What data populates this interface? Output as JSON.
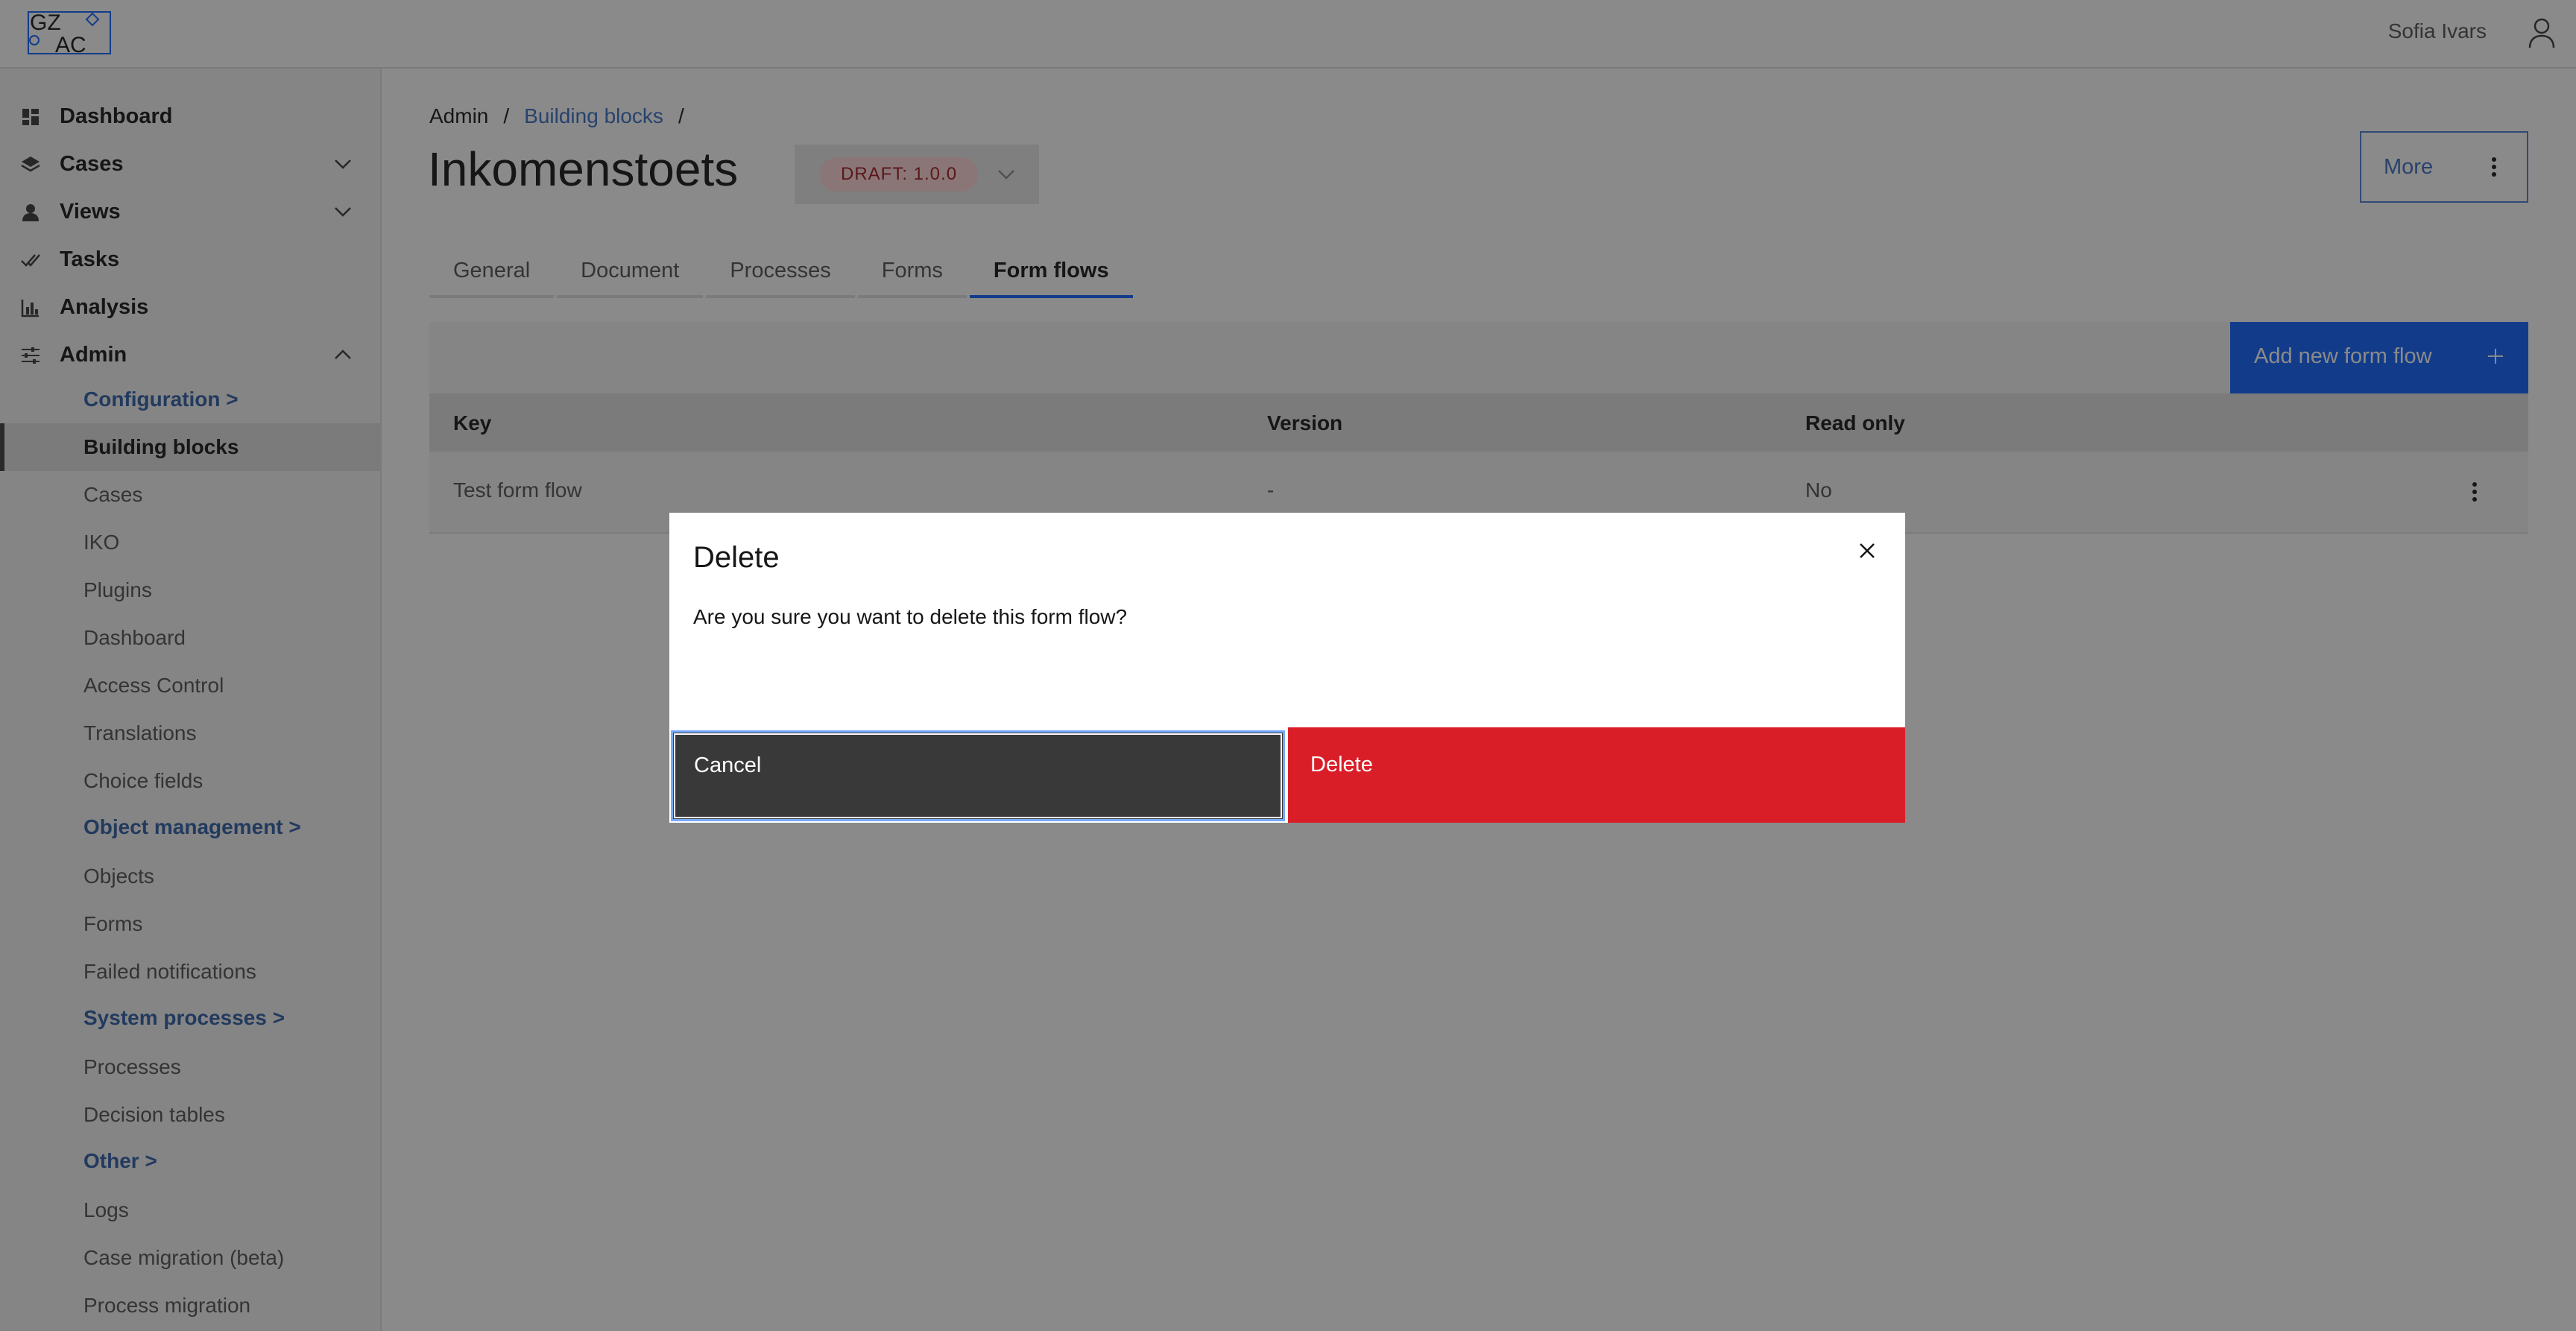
{
  "header": {
    "logo_text_top": "GZ",
    "logo_text_bottom": "AC",
    "user_name": "Sofia Ivars"
  },
  "sidebar": {
    "items": [
      {
        "label": "Dashboard",
        "icon": "dashboard-icon"
      },
      {
        "label": "Cases",
        "icon": "layers-icon"
      },
      {
        "label": "Views",
        "icon": "person-icon"
      },
      {
        "label": "Tasks",
        "icon": "checkmark-icon"
      },
      {
        "label": "Analysis",
        "icon": "bar-chart-icon"
      },
      {
        "label": "Admin",
        "icon": "settings-adjust-icon"
      }
    ],
    "admin_sub": {
      "configuration": "Configuration >",
      "building_blocks": "Building blocks",
      "cases": "Cases",
      "iko": "IKO",
      "plugins": "Plugins",
      "dashboard": "Dashboard",
      "access_control": "Access Control",
      "translations": "Translations",
      "choice_fields": "Choice fields",
      "object_management": "Object management >",
      "objects": "Objects",
      "forms": "Forms",
      "failed_notifications": "Failed notifications",
      "system_processes": "System processes >",
      "processes": "Processes",
      "decision_tables": "Decision tables",
      "other": "Other >",
      "logs": "Logs",
      "case_migration": "Case migration (beta)",
      "process_migration": "Process migration"
    }
  },
  "breadcrumb": {
    "admin": "Admin",
    "sep1": "/",
    "building_blocks": "Building blocks",
    "sep2": "/"
  },
  "page": {
    "title": "Inkomenstoets",
    "draft_tag": "DRAFT: 1.0.0",
    "more_label": "More"
  },
  "tabs": [
    "General",
    "Document",
    "Processes",
    "Forms",
    "Form flows"
  ],
  "toolbar": {
    "add_label": "Add new form flow"
  },
  "table": {
    "headers": {
      "key": "Key",
      "version": "Version",
      "read_only": "Read only"
    },
    "rows": [
      {
        "key": "Test form flow",
        "version": "-",
        "read_only": "No"
      }
    ]
  },
  "modal": {
    "title": "Delete",
    "body": "Are you sure you want to delete this form flow?",
    "cancel_label": "Cancel",
    "delete_label": "Delete"
  },
  "colors": {
    "primary": "#0f62fe",
    "danger": "#da1e28",
    "secondary": "#393939",
    "draft_bg": "#ffd7d9",
    "draft_text": "#a2191f"
  }
}
